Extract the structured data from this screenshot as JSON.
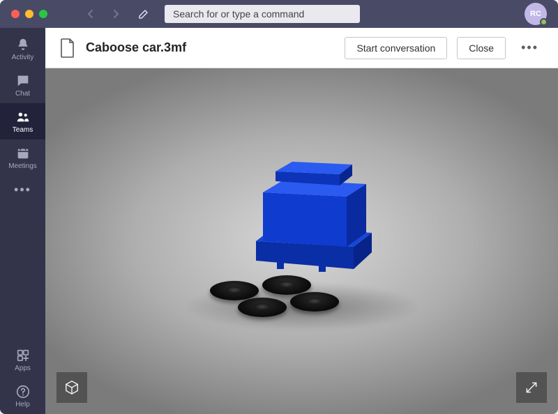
{
  "search": {
    "placeholder": "Search for or type a command"
  },
  "avatar": {
    "initials": "RC"
  },
  "rail": {
    "items": [
      {
        "label": "Activity"
      },
      {
        "label": "Chat"
      },
      {
        "label": "Teams"
      },
      {
        "label": "Meetings"
      }
    ],
    "apps": {
      "label": "Apps"
    },
    "help": {
      "label": "Help"
    }
  },
  "doc": {
    "title": "Caboose car.3mf",
    "start_label": "Start conversation",
    "close_label": "Close"
  }
}
